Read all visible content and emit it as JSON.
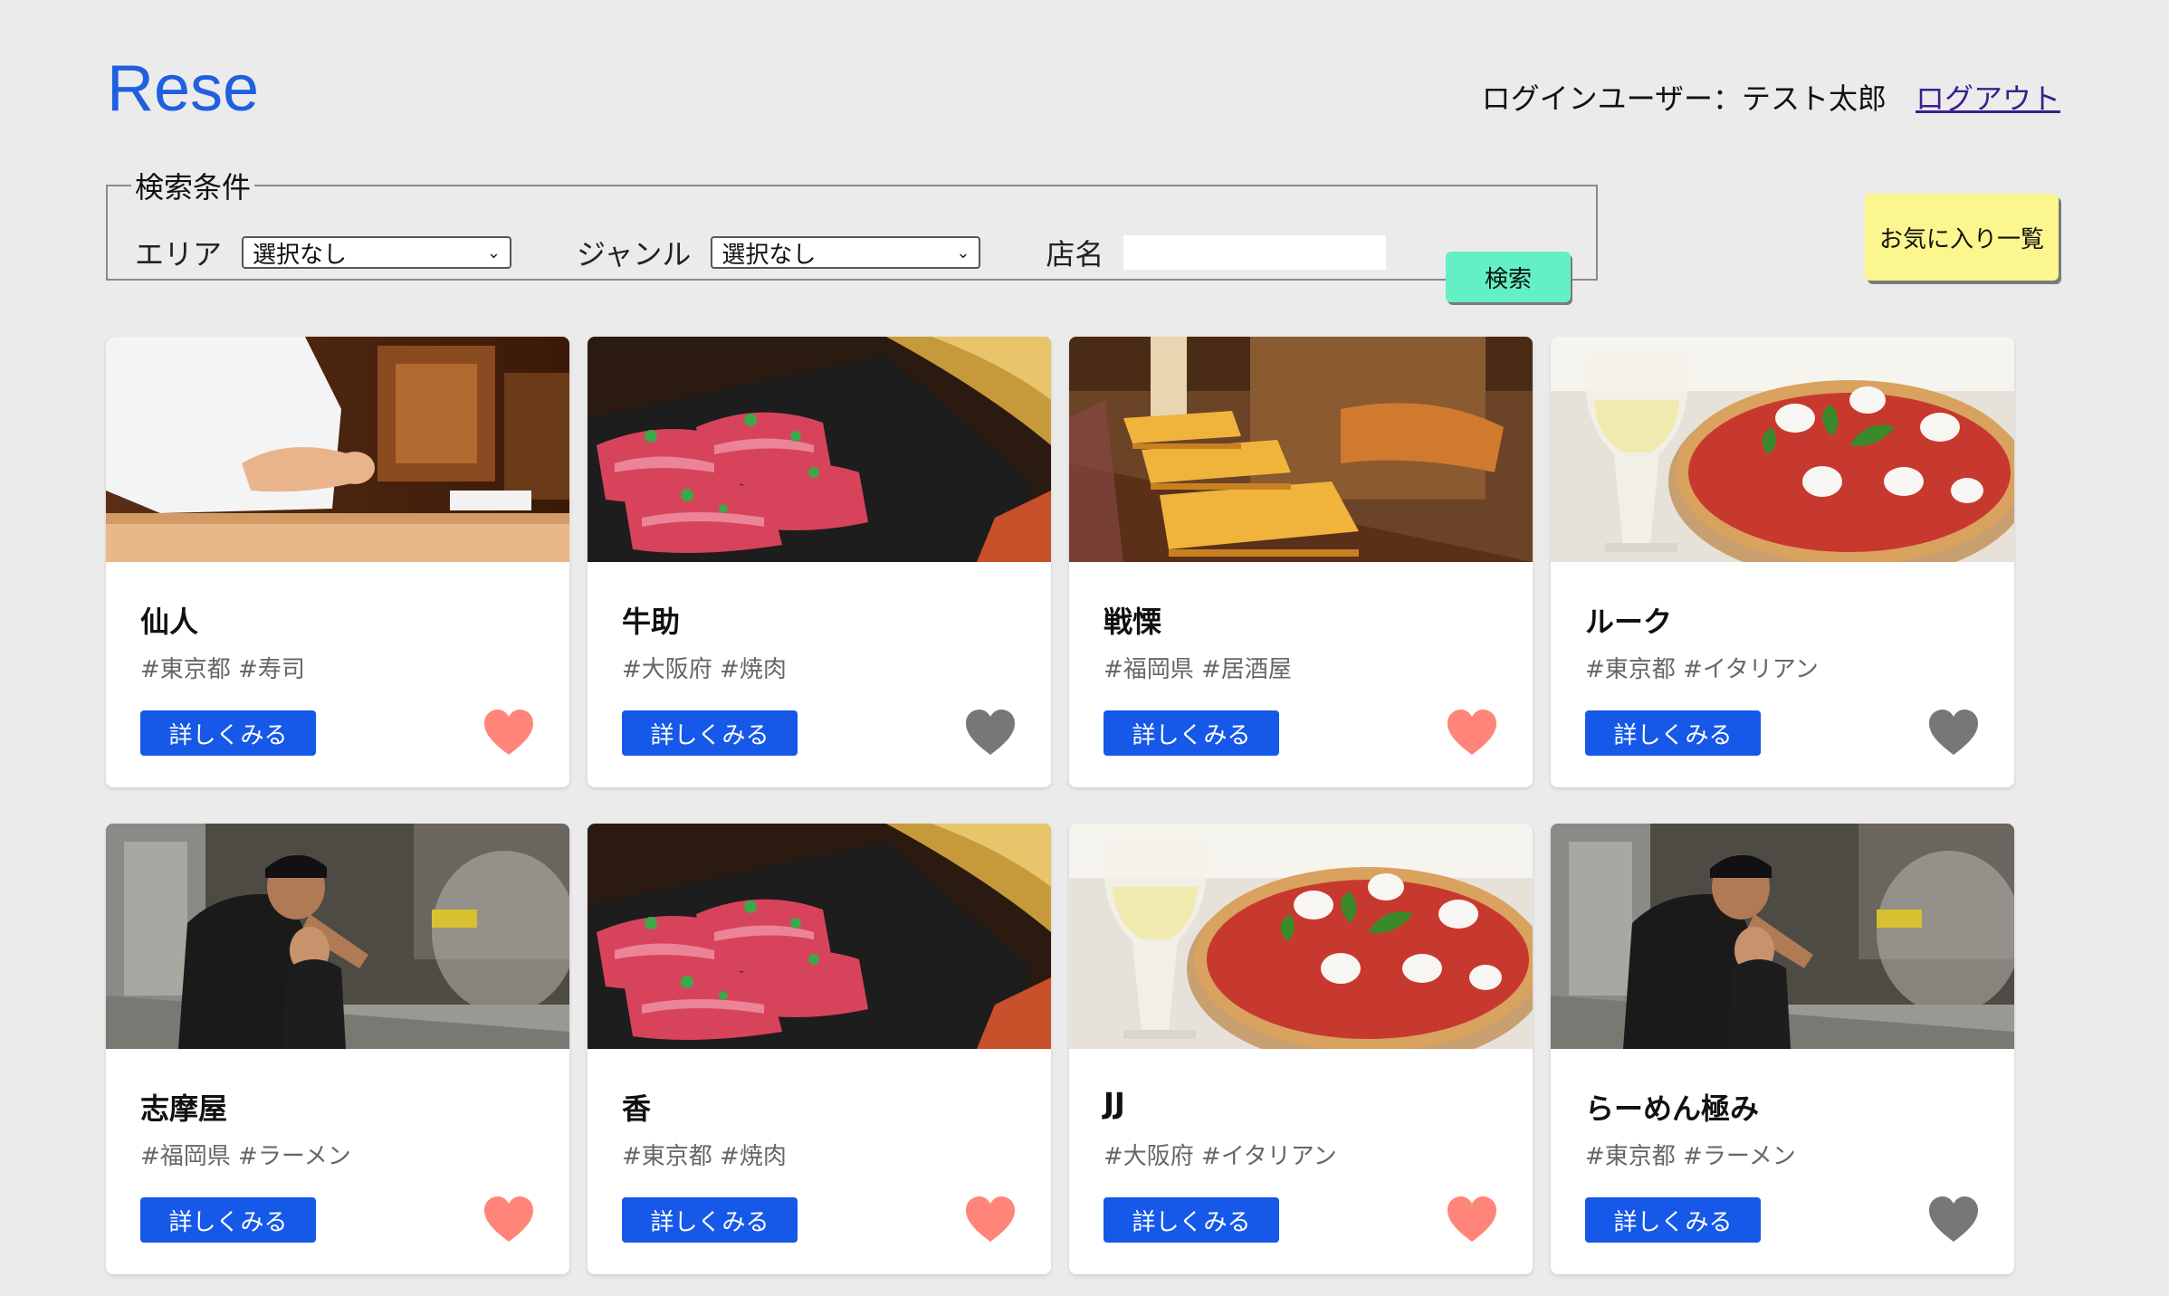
{
  "header": {
    "logo": "Rese",
    "user_label": "ログインユーザー：テスト太郎",
    "logout": "ログアウト"
  },
  "search": {
    "legend": "検索条件",
    "area_label": "エリア",
    "area_value": "選択なし",
    "genre_label": "ジャンル",
    "genre_value": "選択なし",
    "name_label": "店名",
    "name_value": "",
    "button": "検索"
  },
  "favorites_button": "お気に入り一覧",
  "colors": {
    "accent": "#1658e8",
    "heart_on": "#ff8579",
    "heart_off": "#777777"
  },
  "shops": [
    {
      "name": "仙人",
      "tags": "#東京都 #寿司",
      "detail": "詳しくみる",
      "favorite": true,
      "image": "sushi-chef"
    },
    {
      "name": "牛助",
      "tags": "#大阪府 #焼肉",
      "detail": "詳しくみる",
      "favorite": false,
      "image": "yakiniku-meat"
    },
    {
      "name": "戦慄",
      "tags": "#福岡県 #居酒屋",
      "detail": "詳しくみる",
      "favorite": true,
      "image": "izakaya-interior"
    },
    {
      "name": "ルーク",
      "tags": "#東京都 #イタリアン",
      "detail": "詳しくみる",
      "favorite": false,
      "image": "pizza-wine"
    },
    {
      "name": "志摩屋",
      "tags": "#福岡県 #ラーメン",
      "detail": "詳しくみる",
      "favorite": true,
      "image": "ramen-chef"
    },
    {
      "name": "香",
      "tags": "#東京都 #焼肉",
      "detail": "詳しくみる",
      "favorite": true,
      "image": "yakiniku-meat"
    },
    {
      "name": "JJ",
      "tags": "#大阪府 #イタリアン",
      "detail": "詳しくみる",
      "favorite": true,
      "image": "pizza-wine"
    },
    {
      "name": "らーめん極み",
      "tags": "#東京都 #ラーメン",
      "detail": "詳しくみる",
      "favorite": false,
      "image": "ramen-chef"
    }
  ]
}
